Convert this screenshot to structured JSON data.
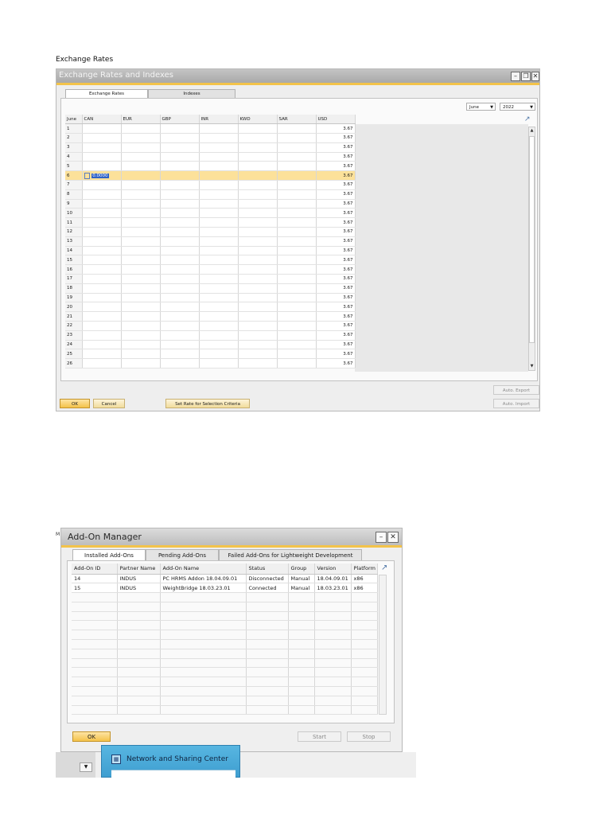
{
  "document": {
    "heading": "Exchange Rates"
  },
  "exchange_window": {
    "title": "Exchange Rates and Indexes",
    "tabs": [
      "Exchange Rates",
      "Indexes"
    ],
    "month": "June",
    "year": "2022",
    "columns": [
      "June",
      "CAN",
      "EUR",
      "GBP",
      "INR",
      "KWD",
      "SAR",
      "USD"
    ],
    "rows": [
      {
        "day": "1",
        "usd": "3.67"
      },
      {
        "day": "2",
        "usd": "3.67"
      },
      {
        "day": "3",
        "usd": "3.67"
      },
      {
        "day": "4",
        "usd": "3.67"
      },
      {
        "day": "5",
        "usd": "3.67"
      },
      {
        "day": "6",
        "usd": "3.67",
        "edit": "0.0000"
      },
      {
        "day": "7",
        "usd": "3.67"
      },
      {
        "day": "8",
        "usd": "3.67"
      },
      {
        "day": "9",
        "usd": "3.67"
      },
      {
        "day": "10",
        "usd": "3.67"
      },
      {
        "day": "11",
        "usd": "3.67"
      },
      {
        "day": "12",
        "usd": "3.67"
      },
      {
        "day": "13",
        "usd": "3.67"
      },
      {
        "day": "14",
        "usd": "3.67"
      },
      {
        "day": "15",
        "usd": "3.67"
      },
      {
        "day": "16",
        "usd": "3.67"
      },
      {
        "day": "17",
        "usd": "3.67"
      },
      {
        "day": "18",
        "usd": "3.67"
      },
      {
        "day": "19",
        "usd": "3.67"
      },
      {
        "day": "20",
        "usd": "3.67"
      },
      {
        "day": "21",
        "usd": "3.67"
      },
      {
        "day": "22",
        "usd": "3.67"
      },
      {
        "day": "23",
        "usd": "3.67"
      },
      {
        "day": "24",
        "usd": "3.67"
      },
      {
        "day": "25",
        "usd": "3.67"
      },
      {
        "day": "26",
        "usd": "3.67"
      }
    ],
    "buttons": {
      "ok": "OK",
      "cancel": "Cancel",
      "set_rate": "Set Rate for Selection Criteria",
      "auto_export": "Auto. Export",
      "auto_import": "Auto. Import"
    }
  },
  "addon_window": {
    "title": "Add-On Manager",
    "tabs": [
      "Installed Add-Ons",
      "Pending Add-Ons",
      "Failed Add-Ons for Lightweight Development"
    ],
    "columns": [
      "Add-On ID",
      "Partner Name",
      "Add-On Name",
      "Status",
      "Group",
      "Version",
      "Platform"
    ],
    "rows": [
      [
        "14",
        "INDUS",
        "PC HRMS Addon 18.04.09.01",
        "Disconnected",
        "Manual",
        "18.04.09.01",
        "x86"
      ],
      [
        "15",
        "INDUS",
        "WeightBridge 18.03.23.01",
        "Connected",
        "Manual",
        "18.03.23.01",
        "x86"
      ]
    ],
    "buttons": {
      "ok": "OK",
      "start": "Start",
      "stop": "Stop"
    }
  },
  "taskbar": {
    "network_center": "Network and Sharing Center"
  }
}
